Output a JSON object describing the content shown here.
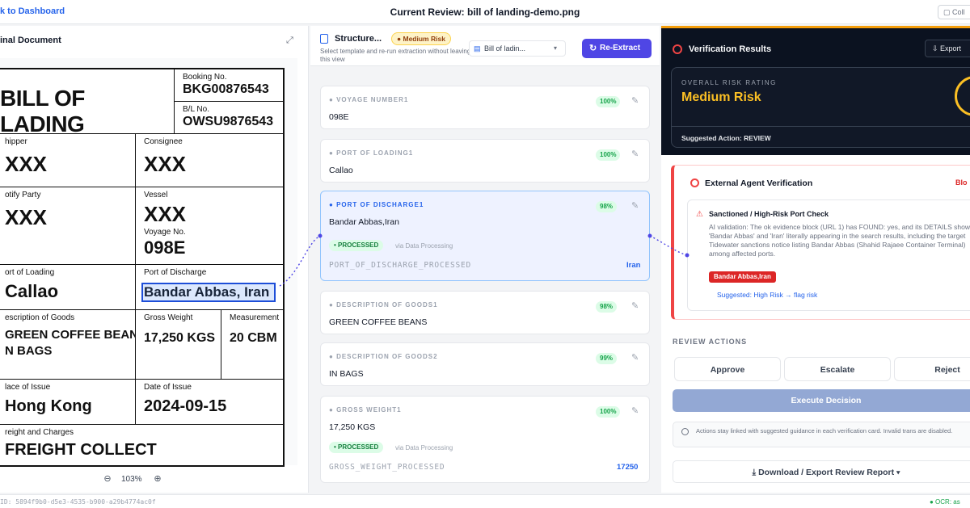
{
  "topbar": {
    "back_label": "k to Dashboard",
    "title": "Current Review: bill of landing-demo.png",
    "right_btn": "Coll"
  },
  "left": {
    "header": "inal Document",
    "doc": {
      "title": "BILL OF LADING",
      "booking_label": "Booking No.",
      "booking_value": "BKG00876543",
      "bl_label": "B/L No.",
      "bl_value": "OWSU9876543",
      "shipper_label": "hipper",
      "shipper_value": "XXX",
      "consignee_label": "Consignee",
      "consignee_value": "XXX",
      "notify_label": "otify Party",
      "notify_value": "XXX",
      "vessel_label": "Vessel",
      "vessel_value": "XXX",
      "voyage_label": "Voyage No.",
      "voyage_value": "098E",
      "pol_label": "ort of Loading",
      "pol_value": "Callao",
      "pod_label": "Port of Discharge",
      "pod_value": "Bandar Abbas, Iran",
      "goods_label": "escription of Goods",
      "goods_value_1": "GREEN COFFEE BEANS",
      "goods_value_2": "N BAGS",
      "gross_label": "Gross Weight",
      "gross_value": "17,250 KGS",
      "meas_label": "Measurement",
      "meas_value": "20 CBM",
      "poi_label": "lace of Issue",
      "poi_value": "Hong Kong",
      "doi_label": "Date of Issue",
      "doi_value": "2024-09-15",
      "freight_label": "reight and Charges",
      "freight_value": "FREIGHT COLLECT"
    },
    "zoom": "103%"
  },
  "middle": {
    "title": "Structure...",
    "risk_pill": "Medium Risk",
    "subtitle": "Select template and re-run extraction without leaving this view",
    "template": "Bill of ladin...",
    "reextract": "Re-Extract",
    "fields": [
      {
        "label": "VOYAGE NUMBER1",
        "value": "098E",
        "conf": "100%"
      },
      {
        "label": "PORT OF LOADING1",
        "value": "Callao",
        "conf": "100%"
      },
      {
        "label": "PORT OF DISCHARGE1",
        "value": "Bandar Abbas,Iran",
        "conf": "98%",
        "processed": "PROCESSED",
        "via": "via Data Processing",
        "proc_key": "PORT_OF_DISCHARGE_PROCESSED",
        "proc_val": "Iran"
      },
      {
        "label": "DESCRIPTION OF GOODS1",
        "value": "GREEN COFFEE BEANS",
        "conf": "98%"
      },
      {
        "label": "DESCRIPTION OF GOODS2",
        "value": "IN BAGS",
        "conf": "99%"
      },
      {
        "label": "GROSS WEIGHT1",
        "value": "17,250 KGS",
        "conf": "100%",
        "processed": "PROCESSED",
        "via": "via Data Processing",
        "proc_key": "GROSS_WEIGHT_PROCESSED",
        "proc_val": "17250"
      }
    ]
  },
  "right": {
    "title": "Verification Results",
    "export": "Export",
    "risk_label": "OVERALL RISK RATING",
    "risk_value": "Medium Risk",
    "suggested_action": "Suggested Action: REVIEW",
    "ext_title": "External Agent Verification",
    "ext_badge": "Blo",
    "check_title": "Sanctioned / High-Risk Port Check",
    "check_text": "AI validation: The ok evidence block (URL 1) has FOUND: yes, and its DETAILS show 'Bandar Abbas' and 'Iran' literally appearing in the search results, including the target Tidewater sanctions notice listing Bandar Abbas (Shahid Rajaee Container Terminal) among affected ports.",
    "check_tag": "Bandar Abbas,Iran",
    "suggested_link": "Suggested: High Risk → flag risk",
    "review_label": "REVIEW ACTIONS",
    "approve": "Approve",
    "escalate": "Escalate",
    "reject": "Reject",
    "execute": "Execute Decision",
    "note": "Actions stay linked with suggested guidance in each verification card. Invalid trans are disabled.",
    "download": "Download / Export Review Report"
  },
  "footer": {
    "id": "ID: 5894f9b0-d5e3-4535-b900-a29b4774ac0f",
    "ocr": "● OCR: as"
  },
  "colors": {
    "accent": "#4f46e5",
    "risk": "#fbbf24",
    "danger": "#dc2626",
    "success": "#16a34a"
  }
}
